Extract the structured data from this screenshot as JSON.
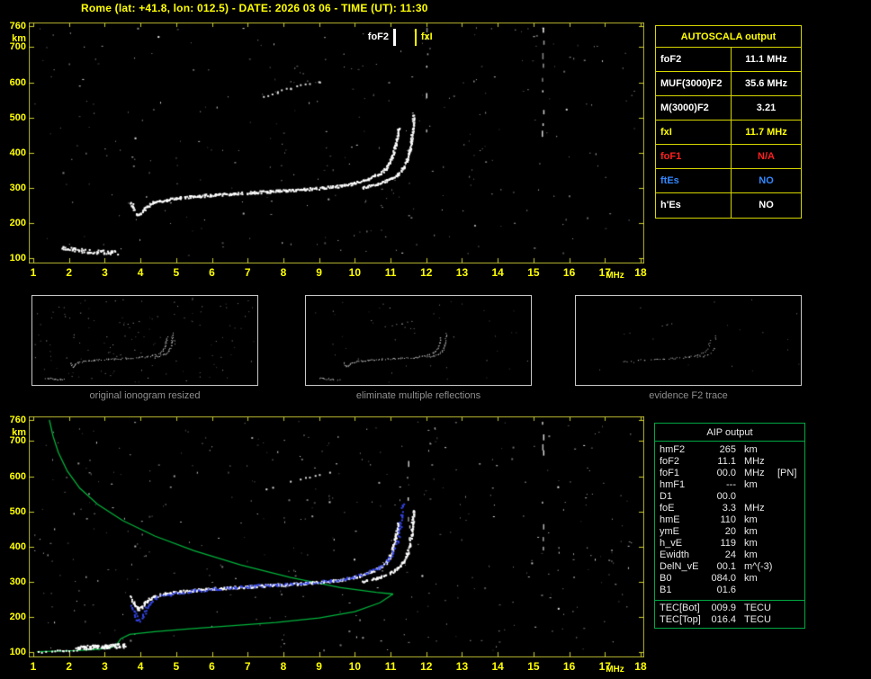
{
  "title": "Rome (lat: +41.8, lon: 012.5) - DATE: 2026 03 06 - TIME (UT): 11:30",
  "colors": {
    "background": "#000000",
    "axis_text": "#ffff00",
    "plot_border": "#b8b830",
    "trace_white": "#ffffff",
    "restored_trace_blue": "#3546ee",
    "profile_green": "#00b43c",
    "autoscala_border": "#d6d600",
    "aip_border": "#00a844",
    "caption_gray": "#8f8f8f",
    "na_red": "#ff2020",
    "ftes_blue": "#3388ff"
  },
  "axes": {
    "x_ticks": [
      1,
      2,
      3,
      4,
      5,
      6,
      7,
      8,
      9,
      10,
      11,
      12,
      13,
      14,
      15,
      16,
      17,
      18
    ],
    "y_ticks": [
      760,
      700,
      600,
      500,
      400,
      300,
      200,
      100
    ],
    "x_unit": "MHz",
    "y_unit": "km",
    "f_range": [
      1,
      18
    ],
    "h_range": [
      100,
      760
    ]
  },
  "markers": {
    "foF2": {
      "label": "foF2",
      "freq": 11.1,
      "color": "#ffffff"
    },
    "fxI": {
      "label": "fxI",
      "freq": 11.7,
      "color": "#ffff00"
    }
  },
  "autoscala_table": {
    "header": "AUTOSCALA output",
    "rows": [
      {
        "label": "foF2",
        "value": "11.1 MHz",
        "color": "#ffffff"
      },
      {
        "label": "MUF(3000)F2",
        "value": "35.6 MHz",
        "color": "#ffffff"
      },
      {
        "label": "M(3000)F2",
        "value": "3.21",
        "color": "#ffffff"
      },
      {
        "label": "fxI",
        "value": "11.7 MHz",
        "color": "#ffff00"
      },
      {
        "label": "foF1",
        "value": "N/A",
        "color": "#ff2020"
      },
      {
        "label": "ftEs",
        "value": "NO",
        "color": "#3388ff"
      },
      {
        "label": "h'Es",
        "value": "NO",
        "color": "#ffffff"
      }
    ]
  },
  "aip_table": {
    "header": "AIP output",
    "rows": [
      {
        "label": "hmF2",
        "value": "265",
        "unit": "km"
      },
      {
        "label": "foF2",
        "value": "11.1",
        "unit": "MHz"
      },
      {
        "label": "foF1",
        "value": "00.0",
        "unit": "MHz",
        "extra": "[PN]"
      },
      {
        "label": "hmF1",
        "value": "---",
        "unit": "km"
      },
      {
        "label": "D1",
        "value": "00.0",
        "unit": ""
      },
      {
        "label": "foE",
        "value": "3.3",
        "unit": "MHz"
      },
      {
        "label": "hmE",
        "value": "110",
        "unit": "km"
      },
      {
        "label": "ymE",
        "value": "20",
        "unit": "km"
      },
      {
        "label": "h_vE",
        "value": "119",
        "unit": "km"
      },
      {
        "label": "Ewidth",
        "value": "24",
        "unit": "km"
      },
      {
        "label": "DelN_vE",
        "value": "00.1",
        "unit": "m^(-3)"
      },
      {
        "label": "B0",
        "value": "084.0",
        "unit": "km"
      },
      {
        "label": "B1",
        "value": "01.6",
        "unit": ""
      }
    ],
    "tec_rows": [
      {
        "label": "TEC[Bot]",
        "value": "009.9",
        "unit": "TECU"
      },
      {
        "label": "TEC[Top]",
        "value": "016.4",
        "unit": "TECU"
      }
    ]
  },
  "thumbnails": [
    {
      "caption": "original ionogram resized"
    },
    {
      "caption": "eliminate multiple reflections"
    },
    {
      "caption": "evidence F2 trace"
    }
  ],
  "chart_data": {
    "type": "scatter",
    "title": "Autoscala ionogram traces (frequency MHz vs virtual height km)",
    "xlabel": "MHz",
    "ylabel": "km",
    "xlim": [
      1,
      18
    ],
    "ylim": [
      100,
      760
    ],
    "top_ionogram": {
      "e_trace": [
        [
          1.8,
          130
        ],
        [
          2.1,
          126
        ],
        [
          2.5,
          122
        ],
        [
          2.9,
          119
        ],
        [
          3.35,
          117
        ]
      ],
      "o_trace": [
        [
          3.72,
          258
        ],
        [
          3.82,
          238
        ],
        [
          3.92,
          224
        ],
        [
          4.02,
          230
        ],
        [
          4.15,
          246
        ],
        [
          4.35,
          259
        ],
        [
          4.7,
          267
        ],
        [
          5.1,
          273
        ],
        [
          5.6,
          278
        ],
        [
          6.1,
          282
        ],
        [
          6.6,
          285
        ],
        [
          7.1,
          288
        ],
        [
          7.6,
          291
        ],
        [
          8.1,
          294
        ],
        [
          8.6,
          297
        ],
        [
          9.1,
          301
        ],
        [
          9.6,
          307
        ],
        [
          10.0,
          315
        ],
        [
          10.35,
          326
        ],
        [
          10.65,
          340
        ],
        [
          10.85,
          356
        ],
        [
          10.95,
          370
        ],
        [
          11.05,
          395
        ],
        [
          11.12,
          425
        ],
        [
          11.17,
          450
        ],
        [
          11.2,
          470
        ]
      ],
      "x_trace": [
        [
          10.2,
          302
        ],
        [
          10.6,
          312
        ],
        [
          10.95,
          325
        ],
        [
          11.2,
          340
        ],
        [
          11.35,
          358
        ],
        [
          11.45,
          380
        ],
        [
          11.52,
          405
        ],
        [
          11.57,
          435
        ],
        [
          11.6,
          470
        ],
        [
          11.63,
          505
        ]
      ],
      "second_hop": [
        [
          7.4,
          562
        ],
        [
          7.8,
          574
        ],
        [
          8.2,
          585
        ],
        [
          8.6,
          595
        ],
        [
          9.0,
          604
        ],
        [
          9.3,
          612
        ]
      ]
    },
    "bottom_ionogram": {
      "bottom_row": [
        [
          1.05,
          103
        ],
        [
          1.4,
          104
        ],
        [
          1.8,
          104
        ],
        [
          2.2,
          105
        ]
      ],
      "es_trace": [
        [
          2.2,
          113
        ],
        [
          2.6,
          116
        ],
        [
          3.0,
          118
        ],
        [
          3.3,
          119
        ],
        [
          3.55,
          120
        ]
      ],
      "o_trace": [
        [
          3.72,
          258
        ],
        [
          3.82,
          238
        ],
        [
          3.92,
          224
        ],
        [
          4.02,
          230
        ],
        [
          4.15,
          246
        ],
        [
          4.35,
          259
        ],
        [
          4.7,
          267
        ],
        [
          5.1,
          273
        ],
        [
          5.6,
          278
        ],
        [
          6.1,
          282
        ],
        [
          6.6,
          285
        ],
        [
          7.1,
          288
        ],
        [
          7.6,
          291
        ],
        [
          8.1,
          294
        ],
        [
          8.6,
          297
        ],
        [
          9.1,
          301
        ],
        [
          9.6,
          307
        ],
        [
          10.0,
          315
        ],
        [
          10.35,
          326
        ],
        [
          10.65,
          340
        ],
        [
          10.85,
          356
        ],
        [
          10.95,
          370
        ],
        [
          11.05,
          395
        ],
        [
          11.12,
          425
        ],
        [
          11.17,
          450
        ],
        [
          11.2,
          470
        ]
      ],
      "x_trace": [
        [
          10.2,
          302
        ],
        [
          10.6,
          312
        ],
        [
          10.95,
          325
        ],
        [
          11.2,
          340
        ],
        [
          11.35,
          358
        ],
        [
          11.45,
          380
        ],
        [
          11.52,
          405
        ],
        [
          11.57,
          435
        ],
        [
          11.6,
          470
        ],
        [
          11.63,
          505
        ]
      ],
      "second_hop": [
        [
          7.4,
          562
        ],
        [
          7.8,
          574
        ],
        [
          8.2,
          585
        ],
        [
          8.6,
          595
        ],
        [
          9.0,
          604
        ],
        [
          9.3,
          612
        ]
      ],
      "blue_trace": [
        [
          3.75,
          235
        ],
        [
          3.85,
          205
        ],
        [
          3.95,
          188
        ],
        [
          4.05,
          205
        ],
        [
          4.2,
          235
        ],
        [
          4.45,
          258
        ],
        [
          4.9,
          268
        ],
        [
          5.5,
          276
        ],
        [
          6.2,
          282
        ],
        [
          7.0,
          288
        ],
        [
          7.8,
          293
        ],
        [
          8.6,
          298
        ],
        [
          9.3,
          304
        ],
        [
          9.9,
          313
        ],
        [
          10.3,
          325
        ],
        [
          10.65,
          340
        ],
        [
          10.9,
          360
        ],
        [
          11.05,
          385
        ],
        [
          11.18,
          420
        ],
        [
          11.26,
          460
        ],
        [
          11.31,
          495
        ],
        [
          11.34,
          525
        ]
      ],
      "green_profile_topside": [
        [
          1.45,
          760
        ],
        [
          1.55,
          715
        ],
        [
          1.7,
          668
        ],
        [
          1.95,
          615
        ],
        [
          2.3,
          566
        ],
        [
          2.8,
          520
        ],
        [
          3.5,
          474
        ],
        [
          4.4,
          430
        ],
        [
          5.5,
          388
        ],
        [
          6.8,
          348
        ],
        [
          8.2,
          312
        ],
        [
          9.6,
          283
        ],
        [
          10.6,
          270
        ],
        [
          11.07,
          265
        ]
      ],
      "green_profile_bottomside": [
        [
          11.07,
          265
        ],
        [
          10.7,
          240
        ],
        [
          10.0,
          215
        ],
        [
          9.0,
          197
        ],
        [
          7.8,
          184
        ],
        [
          6.6,
          175
        ],
        [
          5.4,
          166
        ],
        [
          4.4,
          158
        ],
        [
          3.7,
          150
        ],
        [
          3.45,
          138
        ],
        [
          3.33,
          120
        ],
        [
          3.15,
          111
        ],
        [
          2.7,
          107
        ],
        [
          2.2,
          104
        ],
        [
          1.6,
          102
        ],
        [
          1.1,
          101
        ]
      ]
    }
  }
}
